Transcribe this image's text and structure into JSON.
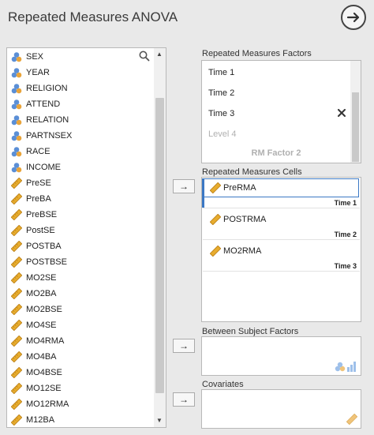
{
  "window": {
    "title": "Repeated Measures ANOVA"
  },
  "variables": [
    {
      "name": "SEX",
      "type": "nominal"
    },
    {
      "name": "YEAR",
      "type": "nominal"
    },
    {
      "name": "RELIGION",
      "type": "nominal"
    },
    {
      "name": "ATTEND",
      "type": "nominal"
    },
    {
      "name": "RELATION",
      "type": "nominal"
    },
    {
      "name": "PARTNSEX",
      "type": "nominal"
    },
    {
      "name": "RACE",
      "type": "nominal"
    },
    {
      "name": "INCOME",
      "type": "nominal"
    },
    {
      "name": "PreSE",
      "type": "continuous"
    },
    {
      "name": "PreBA",
      "type": "continuous"
    },
    {
      "name": "PreBSE",
      "type": "continuous"
    },
    {
      "name": "PostSE",
      "type": "continuous"
    },
    {
      "name": "POSTBA",
      "type": "continuous"
    },
    {
      "name": "POSTBSE",
      "type": "continuous"
    },
    {
      "name": "MO2SE",
      "type": "continuous"
    },
    {
      "name": "MO2BA",
      "type": "continuous"
    },
    {
      "name": "MO2BSE",
      "type": "continuous"
    },
    {
      "name": "MO4SE",
      "type": "continuous"
    },
    {
      "name": "MO4RMA",
      "type": "continuous"
    },
    {
      "name": "MO4BA",
      "type": "continuous"
    },
    {
      "name": "MO4BSE",
      "type": "continuous"
    },
    {
      "name": "MO12SE",
      "type": "continuous"
    },
    {
      "name": "MO12RMA",
      "type": "continuous"
    },
    {
      "name": "M12BA",
      "type": "continuous"
    }
  ],
  "rm_factors": {
    "label": "Repeated Measures Factors",
    "levels": [
      "Time 1",
      "Time 2",
      "Time 3"
    ],
    "placeholder_level": "Level 4",
    "placeholder_factor": "RM Factor 2"
  },
  "rm_cells": {
    "label": "Repeated Measures Cells",
    "cells": [
      {
        "variable": "PreRMA",
        "level": "Time 1"
      },
      {
        "variable": "POSTRMA",
        "level": "Time 2"
      },
      {
        "variable": "MO2RMA",
        "level": "Time 3"
      }
    ]
  },
  "between": {
    "label": "Between Subject Factors"
  },
  "covariates": {
    "label": "Covariates"
  },
  "buttons": {
    "move": "→"
  },
  "colors": {
    "accent": "#3b78c4",
    "ruler": "#e0a52a",
    "nominal_blue": "#5b8fd6",
    "nominal_orange": "#e9a43a"
  }
}
